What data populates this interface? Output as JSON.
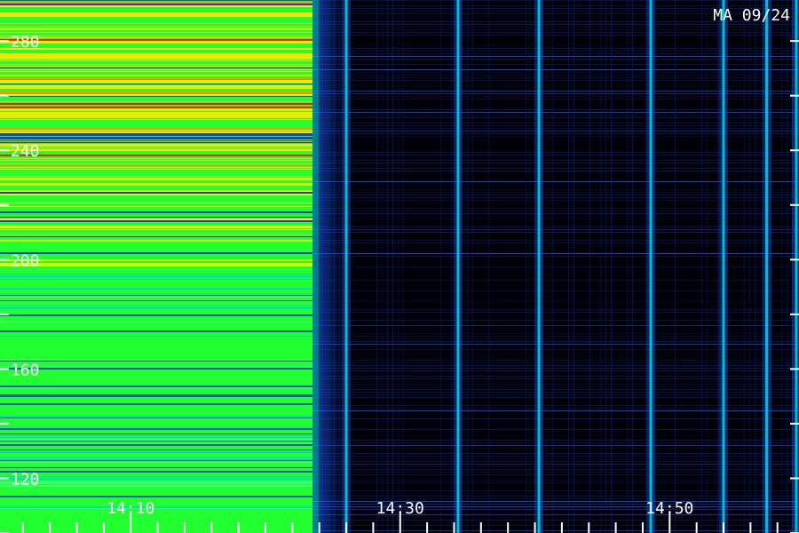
{
  "chart_data": {
    "type": "heatmap",
    "title": "MA 09/24",
    "x": {
      "ticks": [
        {
          "value": 10,
          "label": "14:10"
        },
        {
          "value": 30,
          "label": "14:30"
        },
        {
          "value": 50,
          "label": "14:50"
        }
      ],
      "minor_step": 2,
      "range": [
        0.3,
        59.6
      ]
    },
    "y": {
      "ticks": [
        {
          "value": 120,
          "label": "120"
        },
        {
          "value": 160,
          "label": "160"
        },
        {
          "value": 200,
          "label": "200"
        },
        {
          "value": 240,
          "label": "240"
        },
        {
          "value": 280,
          "label": "280"
        }
      ],
      "minor_step": 20,
      "range": [
        100,
        295
      ]
    },
    "segments": [
      {
        "from": 0.3,
        "to": 23.5,
        "level": "high"
      },
      {
        "from": 23.5,
        "to": 59.6,
        "level": "low"
      }
    ],
    "bursts": [
      26.0,
      34.3,
      40.3,
      48.6,
      54.0,
      57.2,
      59.4
    ],
    "colors": {
      "background": "#000000",
      "low": "#0a1f66",
      "mid": "#00d0d8",
      "high": "#22ff30",
      "peak": "#ff2000",
      "axis": "#ffffff"
    }
  }
}
